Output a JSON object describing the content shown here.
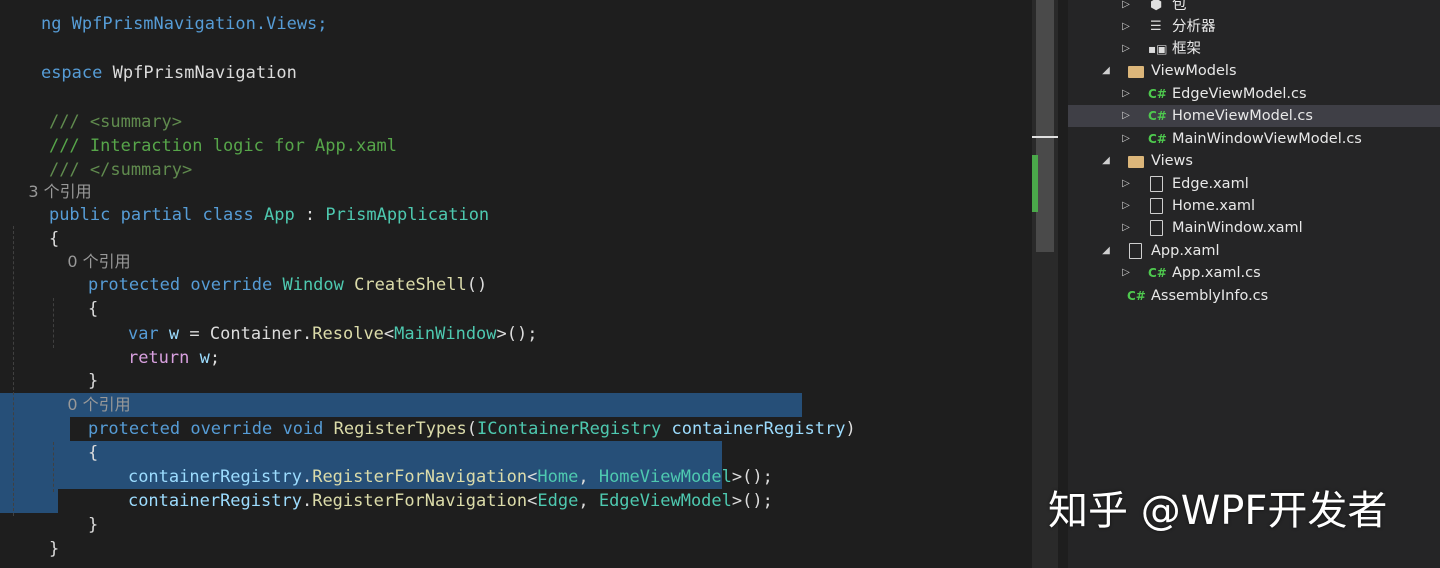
{
  "code": {
    "l0": [
      "ng WpfPrismNavigation.Views;"
    ],
    "l1": [
      "espace",
      " WpfPrismNavigation"
    ],
    "l2": [
      "/// ",
      "<summary>"
    ],
    "l3": [
      "/// Interaction logic for App.xaml"
    ],
    "l4": [
      "/// ",
      "</summary>"
    ],
    "l5": [
      "3 个引用"
    ],
    "l6": [
      "public",
      " ",
      "partial",
      " ",
      "class",
      " ",
      "App",
      " : ",
      "PrismApplication"
    ],
    "l7": [
      "{"
    ],
    "l8": [
      "0 个引用"
    ],
    "l9": [
      "protected",
      " ",
      "override",
      " ",
      "Window",
      " ",
      "CreateShell",
      "()"
    ],
    "l10": [
      "{"
    ],
    "l11": [
      "var",
      " ",
      "w",
      " = ",
      "Container",
      ".",
      "Resolve",
      "<",
      "MainWindow",
      ">();"
    ],
    "l12": [
      "return",
      " ",
      "w",
      ";"
    ],
    "l13": [
      "}"
    ],
    "l14": [
      "0 个引用"
    ],
    "l15": [
      "protected",
      " ",
      "override",
      " ",
      "void",
      " ",
      "RegisterTypes",
      "(",
      "IContainerRegistry",
      " ",
      "containerRegistry",
      ")"
    ],
    "l16": [
      "{"
    ],
    "l17": [
      "containerRegistry",
      ".",
      "RegisterForNavigation",
      "<",
      "Home",
      ", ",
      "HomeViewModel",
      ">();"
    ],
    "l18": [
      "containerRegistry",
      ".",
      "RegisterForNavigation",
      "<",
      "Edge",
      ", ",
      "EdgeViewModel",
      ">();"
    ],
    "l19": [
      "}"
    ],
    "l20": [
      "}"
    ]
  },
  "explorer": {
    "items": [
      {
        "label": "包",
        "icon": "package-icon"
      },
      {
        "label": "分析器",
        "icon": "analyzer-icon"
      },
      {
        "label": "框架",
        "icon": "framework-icon"
      },
      {
        "label": "ViewModels",
        "icon": "folder-icon"
      },
      {
        "label": "EdgeViewModel.cs",
        "icon": "csharp-file-icon"
      },
      {
        "label": "HomeViewModel.cs",
        "icon": "csharp-file-icon"
      },
      {
        "label": "MainWindowViewModel.cs",
        "icon": "csharp-file-icon"
      },
      {
        "label": "Views",
        "icon": "folder-icon"
      },
      {
        "label": "Edge.xaml",
        "icon": "xaml-file-icon"
      },
      {
        "label": "Home.xaml",
        "icon": "xaml-file-icon"
      },
      {
        "label": "MainWindow.xaml",
        "icon": "xaml-file-icon"
      },
      {
        "label": "App.xaml",
        "icon": "xaml-file-icon"
      },
      {
        "label": "App.xaml.cs",
        "icon": "csharp-file-icon"
      },
      {
        "label": "AssemblyInfo.cs",
        "icon": "csharp-file-icon"
      }
    ],
    "cs_glyph": "C#"
  },
  "watermark": "知乎 @WPF开发者",
  "colors": {
    "keyword": "#569cd6",
    "control_keyword": "#d8a0df",
    "type": "#4ec9b0",
    "method": "#dcdcaa",
    "comment": "#57a64a",
    "selection": "#264f78",
    "editor_bg": "#1e1e1e",
    "explorer_bg": "#252526"
  }
}
